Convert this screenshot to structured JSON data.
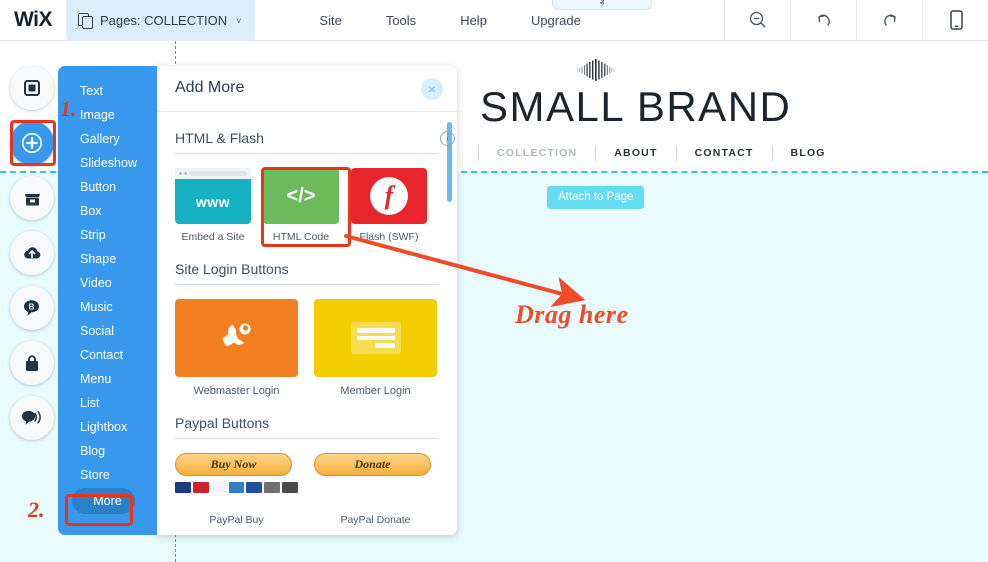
{
  "topbar": {
    "logo": "WiX",
    "pages_chip": {
      "label": "Pages: COLLECTION",
      "icon": "pages-icon",
      "caret": "˅"
    },
    "menu": [
      {
        "label": "Site"
      },
      {
        "label": "Tools"
      },
      {
        "label": "Help"
      },
      {
        "label": "Upgrade"
      }
    ],
    "tools": [
      {
        "name": "zoom-out-icon"
      },
      {
        "name": "undo-icon"
      },
      {
        "name": "redo-icon"
      },
      {
        "name": "mobile-view-icon"
      }
    ],
    "collapse_chevron": "ⱏ"
  },
  "rail": {
    "items": [
      {
        "name": "pages-square-icon",
        "active": false
      },
      {
        "name": "add-plus-icon",
        "active": true
      },
      {
        "name": "app-market-icon",
        "active": false
      },
      {
        "name": "my-uploads-icon",
        "active": false
      },
      {
        "name": "blog-icon",
        "active": false
      },
      {
        "name": "store-bag-icon",
        "active": false
      },
      {
        "name": "chat-icon",
        "active": false
      }
    ]
  },
  "flyout": {
    "items": [
      {
        "label": "Text"
      },
      {
        "label": "Image"
      },
      {
        "label": "Gallery"
      },
      {
        "label": "Slideshow"
      },
      {
        "label": "Button"
      },
      {
        "label": "Box"
      },
      {
        "label": "Strip"
      },
      {
        "label": "Shape"
      },
      {
        "label": "Video"
      },
      {
        "label": "Music"
      },
      {
        "label": "Social"
      },
      {
        "label": "Contact"
      },
      {
        "label": "Menu"
      },
      {
        "label": "List"
      },
      {
        "label": "Lightbox"
      },
      {
        "label": "Blog"
      },
      {
        "label": "Store"
      }
    ],
    "more_label": "More"
  },
  "panel": {
    "title": "Add More",
    "close_icon": "×",
    "sections": [
      {
        "title": "HTML & Flash",
        "has_info": true,
        "info_icon": "i",
        "tiles": [
          {
            "caption": "Embed a Site",
            "icon": "www-icon",
            "icon_text": "www",
            "color": "#16b2c4"
          },
          {
            "caption": "HTML Code",
            "icon": "code-brackets-icon",
            "icon_text": "</>",
            "color": "#6cbb5a"
          },
          {
            "caption": "Flash (SWF)",
            "icon": "flash-icon",
            "icon_text": "f",
            "color": "#e8252a"
          }
        ]
      },
      {
        "title": "Site Login Buttons",
        "has_info": false,
        "tiles": [
          {
            "caption": "Webmaster Login",
            "icon": "wrench-icon",
            "color": "#f28020"
          },
          {
            "caption": "Member Login",
            "icon": "form-lines-icon",
            "color": "#f2cd00"
          }
        ]
      },
      {
        "title": "Paypal Buttons",
        "has_info": false,
        "tiles": [
          {
            "caption": "PayPal Buy",
            "button_label": "Buy Now",
            "icon": "credit-cards-icon"
          },
          {
            "caption": "PayPal Donate",
            "button_label": "Donate",
            "icon": "paypal-donate-icon"
          }
        ]
      }
    ]
  },
  "site": {
    "brand_title": "SMALL BRAND",
    "brand_mark": "fan-logo-icon",
    "nav": [
      {
        "label": "COLLECTION",
        "current": true
      },
      {
        "label": "ABOUT",
        "current": false
      },
      {
        "label": "CONTACT",
        "current": false
      },
      {
        "label": "BLOG",
        "current": false
      }
    ],
    "attach_badge": "Attach to Page"
  },
  "annotations": {
    "step_one": "1.",
    "step_two": "2.",
    "drag_text": "Drag here",
    "accent_color": "#e8361c"
  }
}
